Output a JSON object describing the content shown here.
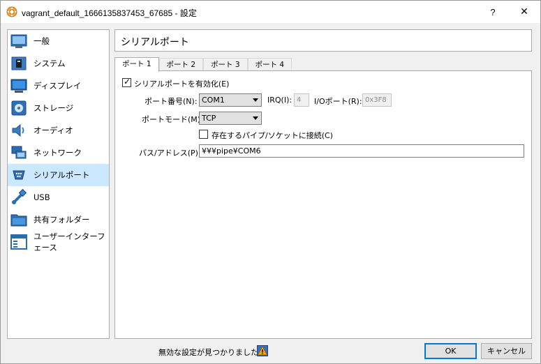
{
  "window": {
    "title": "vagrant_default_1666135837453_67685 - 設定",
    "help_label": "?",
    "close_label": "✕"
  },
  "sidebar": {
    "items": [
      {
        "label": "一般",
        "icon": "general-icon"
      },
      {
        "label": "システム",
        "icon": "system-icon"
      },
      {
        "label": "ディスプレイ",
        "icon": "display-icon"
      },
      {
        "label": "ストレージ",
        "icon": "storage-icon"
      },
      {
        "label": "オーディオ",
        "icon": "audio-icon"
      },
      {
        "label": "ネットワーク",
        "icon": "network-icon"
      },
      {
        "label": "シリアルポート",
        "icon": "serial-port-icon",
        "selected": true
      },
      {
        "label": "USB",
        "icon": "usb-icon"
      },
      {
        "label": "共有フォルダー",
        "icon": "shared-folder-icon"
      },
      {
        "label": "ユーザーインターフェース",
        "icon": "user-interface-icon"
      }
    ]
  },
  "header": {
    "title": "シリアルポート"
  },
  "tabs": [
    {
      "label": "ポート 1",
      "active": true
    },
    {
      "label": "ポート 2"
    },
    {
      "label": "ポート 3"
    },
    {
      "label": "ポート 4"
    }
  ],
  "port": {
    "enable_label": "シリアルポートを有効化(E)",
    "enable_checked": true,
    "port_number_label": "ポート番号(N):",
    "port_number_value": "COM1",
    "irq_label": "IRQ(I):",
    "irq_value": "4",
    "io_port_label": "I/Oポート(R):",
    "io_port_value": "0x3F8",
    "mode_label": "ポートモード(M):",
    "mode_value": "TCP",
    "connect_label": "存在するパイプ/ソケットに接続(C)",
    "connect_checked": false,
    "path_label": "パス/アドレス(P):",
    "path_value": "¥¥¥pipe¥COM6"
  },
  "footer": {
    "status_text": "無効な設定が見つかりました",
    "ok_label": "OK",
    "cancel_label": "キャンセル"
  },
  "colors": {
    "selected_bg": "#cce8ff",
    "ok_border": "#0078d7",
    "warning": "#f7a600"
  }
}
